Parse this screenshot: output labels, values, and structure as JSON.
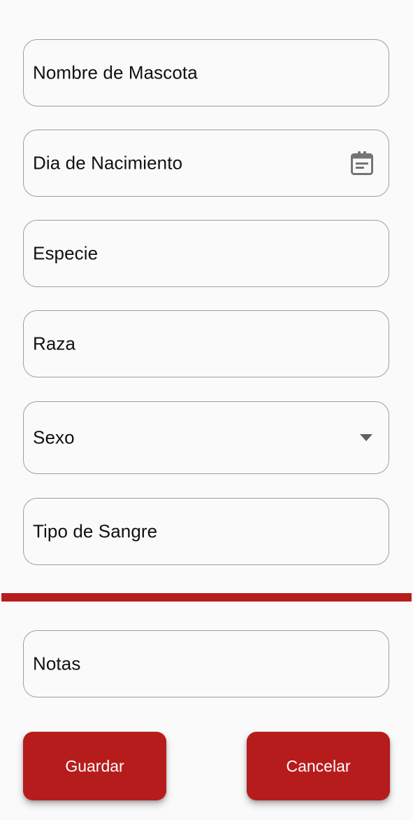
{
  "form": {
    "fields": [
      {
        "id": "nombre",
        "label": "Nombre de Mascota"
      },
      {
        "id": "nacimiento",
        "label": "Dia de Nacimiento",
        "icon": "calendar-icon"
      },
      {
        "id": "especie",
        "label": "Especie"
      },
      {
        "id": "raza",
        "label": "Raza"
      },
      {
        "id": "sexo",
        "label": "Sexo",
        "icon": "dropdown-arrow-icon"
      },
      {
        "id": "sangre",
        "label": "Tipo de Sangre"
      },
      {
        "id": "notas",
        "label": "Notas"
      }
    ]
  },
  "actions": {
    "save_label": "Guardar",
    "cancel_label": "Cancelar"
  },
  "colors": {
    "accent": "#b71c1c",
    "border": "#9e9e9e",
    "background": "#fafafa"
  }
}
